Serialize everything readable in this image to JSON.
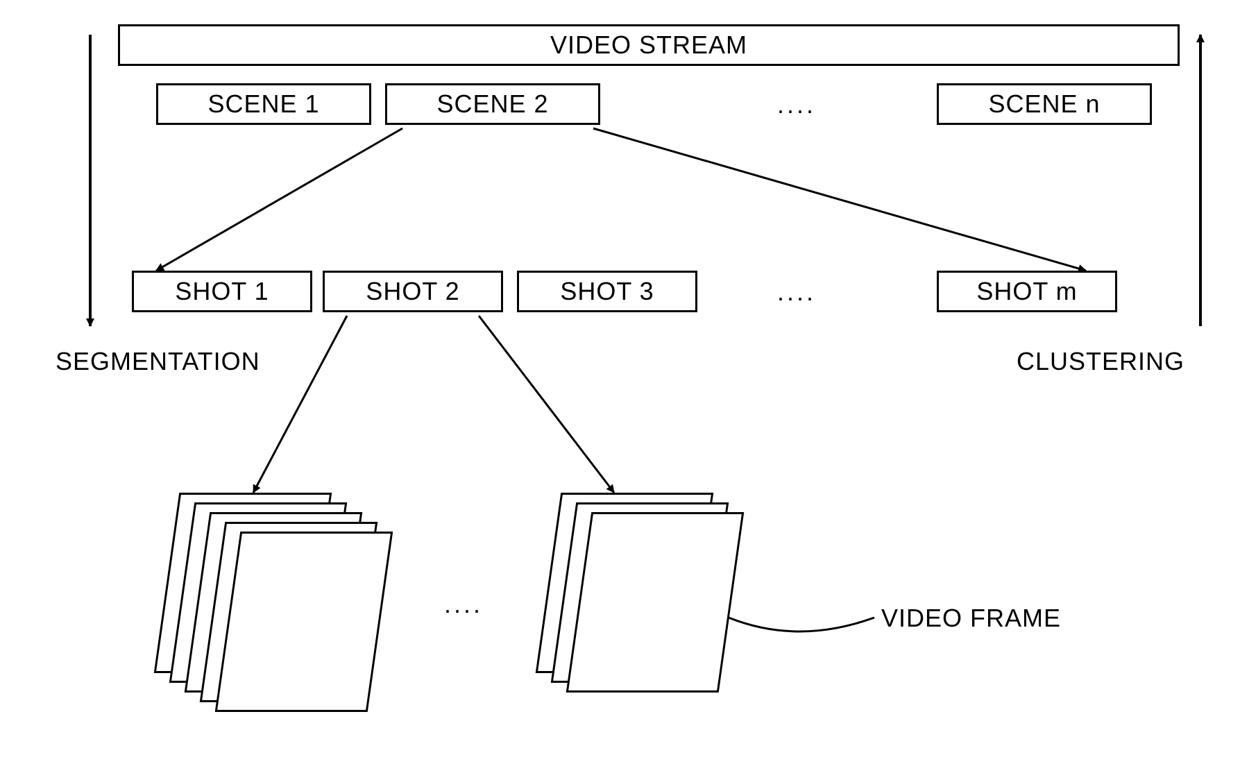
{
  "title": "VIDEO STREAM",
  "scenes": [
    "SCENE 1",
    "SCENE 2",
    "SCENE n"
  ],
  "scene_ellipsis": "....",
  "shots": [
    "SHOT 1",
    "SHOT 2",
    "SHOT 3",
    "SHOT m"
  ],
  "shot_ellipsis": "....",
  "frame_ellipsis": "....",
  "left_label": "SEGMENTATION",
  "right_label": "CLUSTERING",
  "frame_label": "VIDEO FRAME"
}
